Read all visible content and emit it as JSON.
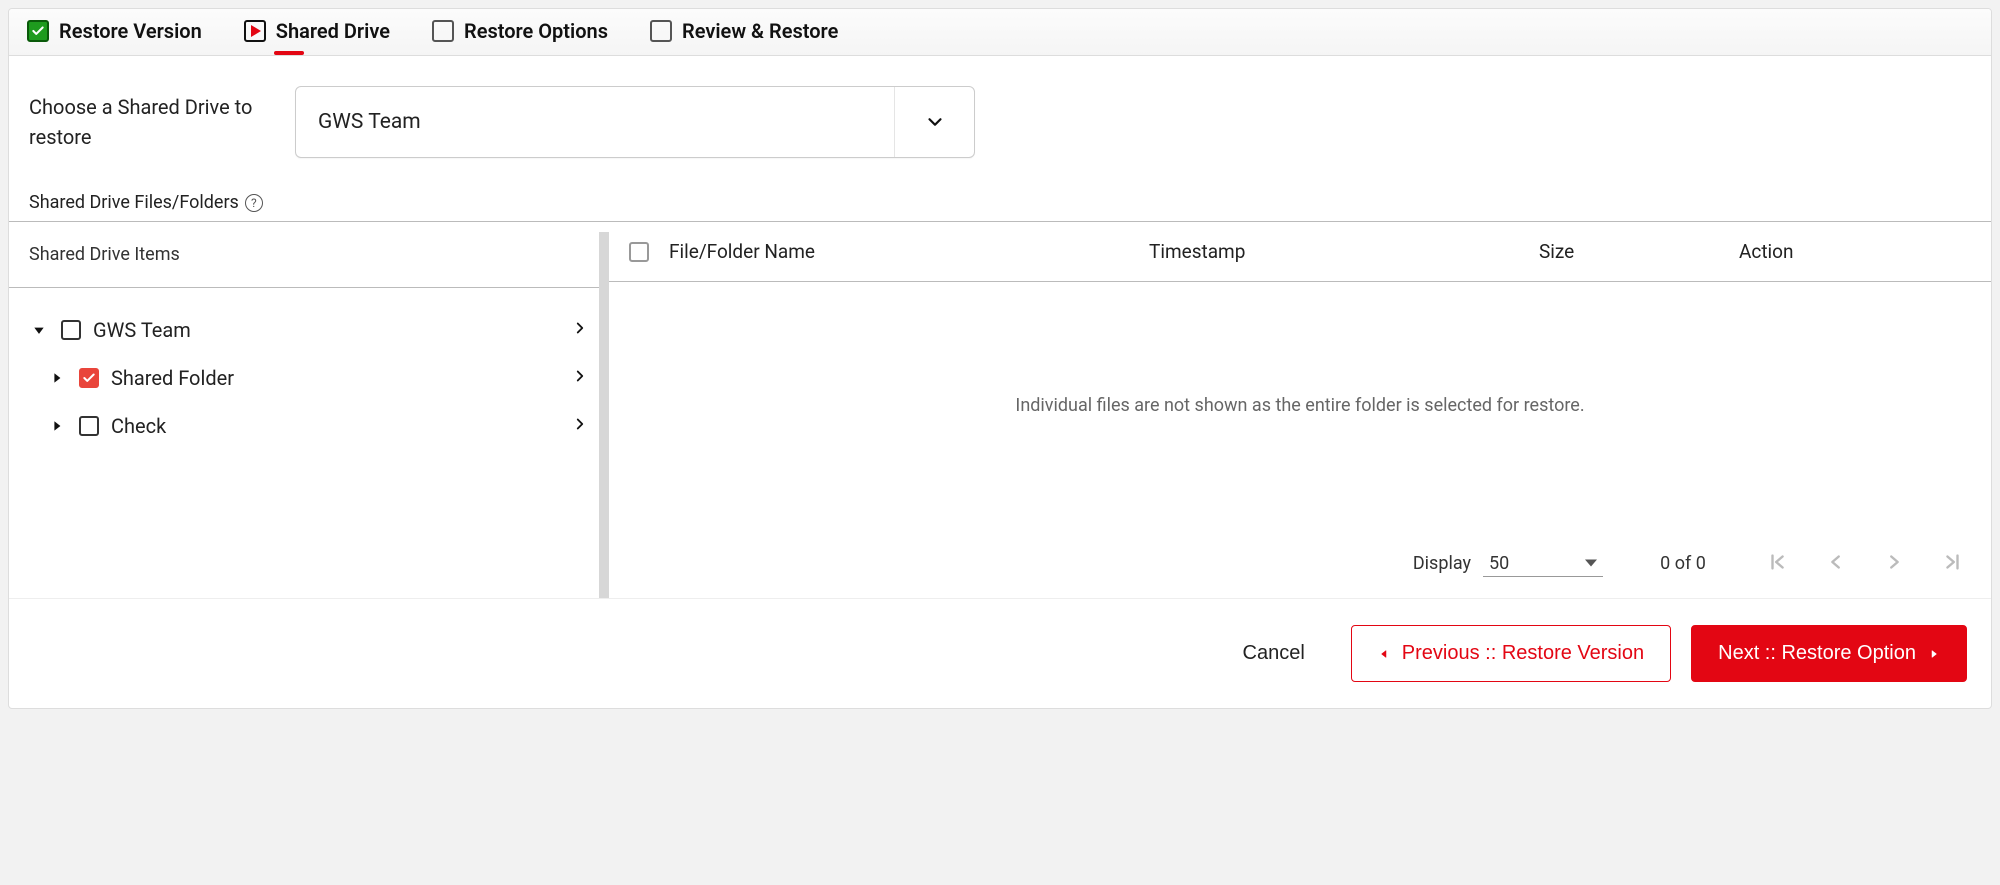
{
  "stepper": {
    "steps": [
      {
        "label": "Restore Version",
        "state": "done"
      },
      {
        "label": "Shared Drive",
        "state": "active"
      },
      {
        "label": "Restore Options",
        "state": "pending"
      },
      {
        "label": "Review & Restore",
        "state": "pending"
      }
    ]
  },
  "chooser": {
    "label": "Choose a Shared Drive to restore",
    "selected": "GWS Team"
  },
  "section_title": "Shared Drive Files/Folders",
  "tree": {
    "header": "Shared Drive Items",
    "items": [
      {
        "label": "GWS Team",
        "expanded": true,
        "checked": false,
        "depth": 0
      },
      {
        "label": "Shared Folder",
        "expanded": false,
        "checked": true,
        "depth": 1
      },
      {
        "label": "Check",
        "expanded": false,
        "checked": false,
        "depth": 1
      }
    ]
  },
  "table": {
    "columns": {
      "name": "File/Folder Name",
      "timestamp": "Timestamp",
      "size": "Size",
      "action": "Action"
    },
    "empty_message": "Individual files are not shown as the entire folder is selected for restore."
  },
  "pager": {
    "display_label": "Display",
    "page_size": "50",
    "count_text": "0 of 0"
  },
  "footer": {
    "cancel": "Cancel",
    "previous": "Previous :: Restore Version",
    "next": "Next :: Restore Option"
  }
}
